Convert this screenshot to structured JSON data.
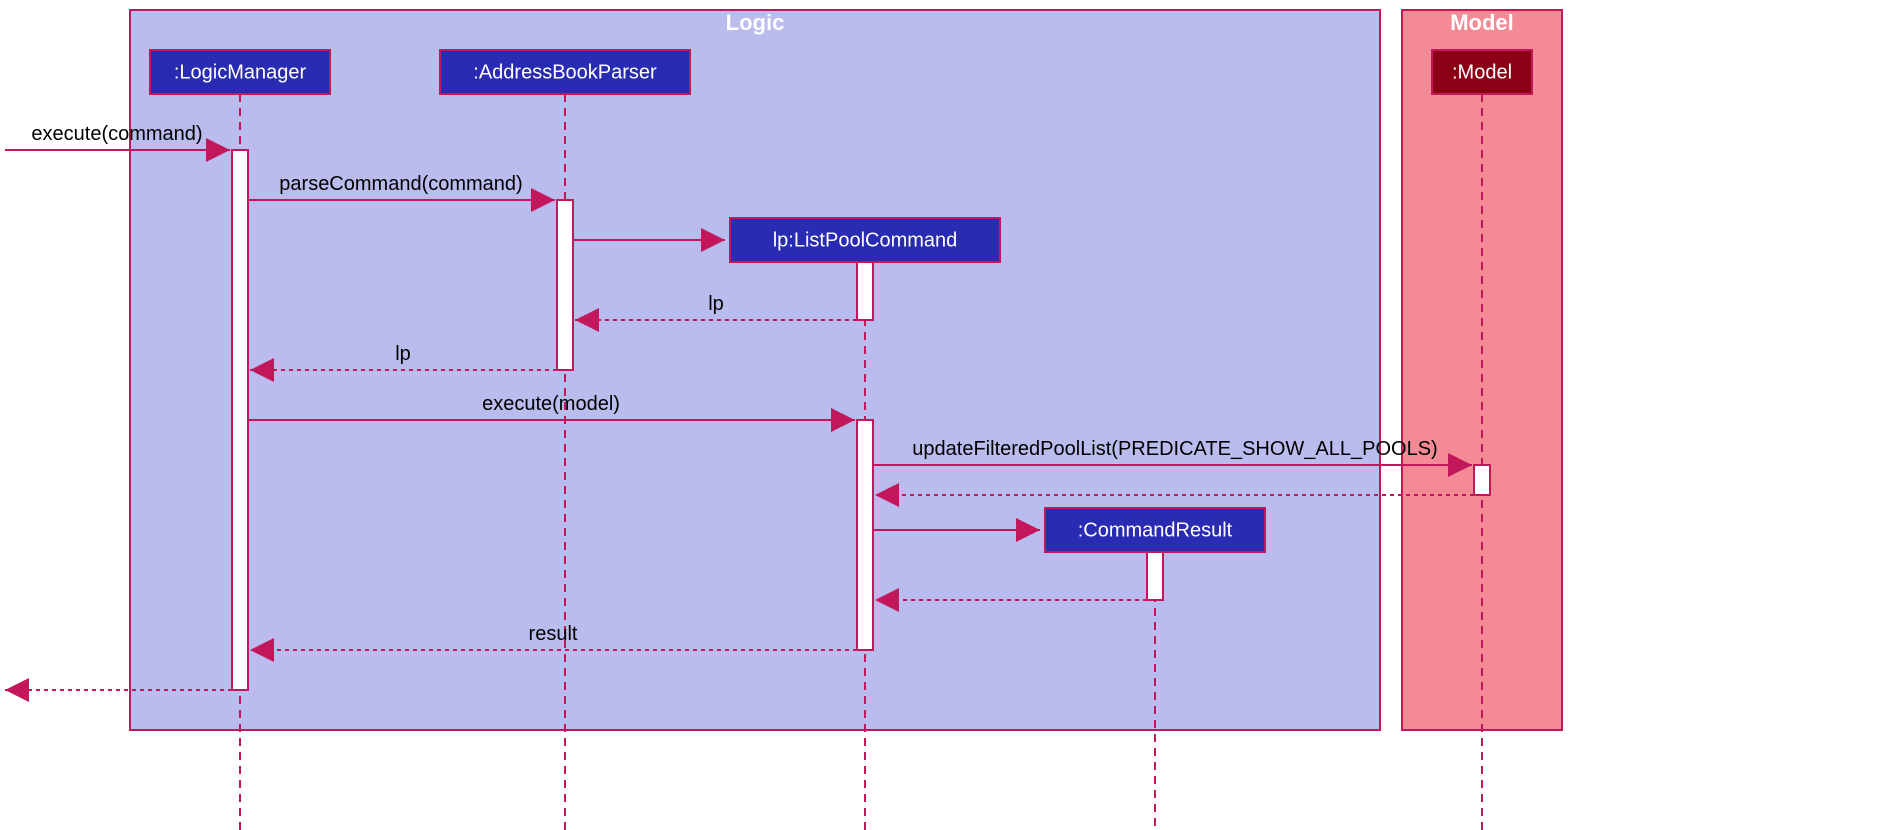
{
  "frames": {
    "logic": {
      "label": "Logic"
    },
    "model": {
      "label": "Model"
    }
  },
  "participants": {
    "logicManager": {
      "label": ":LogicManager"
    },
    "addressBookParser": {
      "label": ":AddressBookParser"
    },
    "listPoolCommand": {
      "label": "lp:ListPoolCommand"
    },
    "commandResult": {
      "label": ":CommandResult"
    },
    "model": {
      "label": ":Model"
    }
  },
  "messages": {
    "executeCommand": "execute(command)",
    "parseCommand": "parseCommand(command)",
    "returnLp1": "lp",
    "returnLp2": "lp",
    "executeModel": "execute(model)",
    "updateFilteredPoolList": "updateFilteredPoolList(PREDICATE_SHOW_ALL_POOLS)",
    "result": "result"
  }
}
